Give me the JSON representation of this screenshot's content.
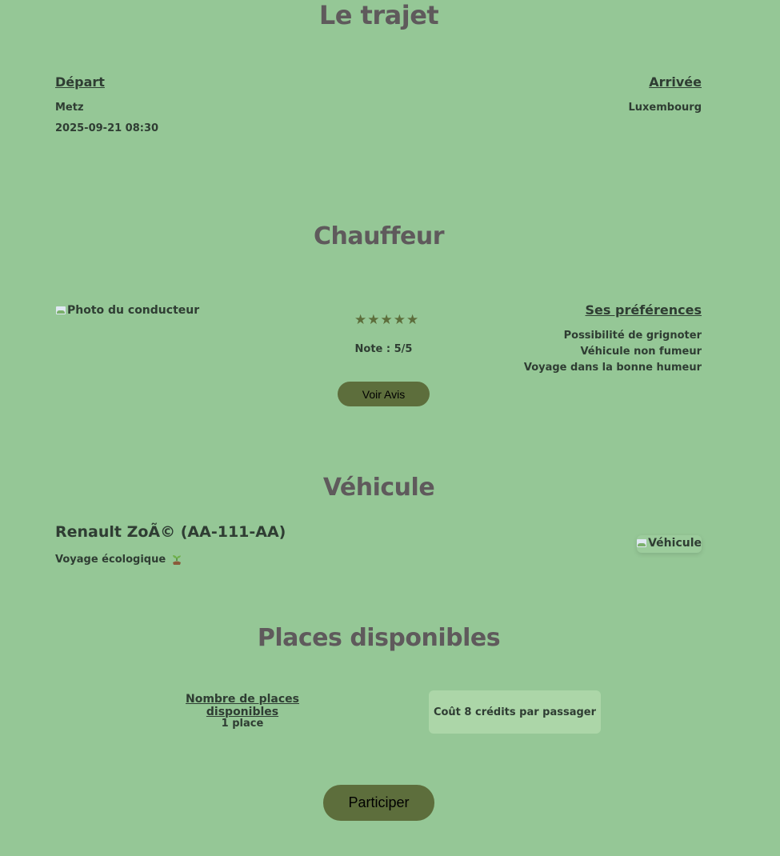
{
  "trajet": {
    "title": "Le trajet",
    "depart_label": "Départ",
    "depart_city": "Metz",
    "depart_datetime": "2025-09-21 08:30",
    "arrivee_label": "Arrivée",
    "arrivee_city": "Luxembourg"
  },
  "chauffeur": {
    "title": "Chauffeur",
    "photo_alt": "Photo du conducteur",
    "rating_stars": 5,
    "star_glyph": "★",
    "note_text": "Note : 5/5",
    "voir_avis_label": "Voir Avis",
    "preferences_label": "Ses préférences",
    "preferences": [
      "Possibilité de grignoter",
      "Véhicule non fumeur",
      "Voyage dans la bonne humeur"
    ]
  },
  "vehicule": {
    "title": "Véhicule",
    "name": "Renault ZoÃ© (AA-111-AA)",
    "eco_text": "Voyage écologique",
    "eco_icon": "seedling-icon",
    "image_alt": "Véhicule"
  },
  "places": {
    "title": "Places disponibles",
    "nombre_label": "Nombre de places disponibles",
    "nombre_value": "1 place",
    "cost_text": "Coût 8 crédits par passager"
  },
  "participer_label": "Participer",
  "colors": {
    "background": "#95c796",
    "button": "#5d6e3c",
    "title": "#5f5a5c",
    "cost_box": "#acd6a8"
  }
}
